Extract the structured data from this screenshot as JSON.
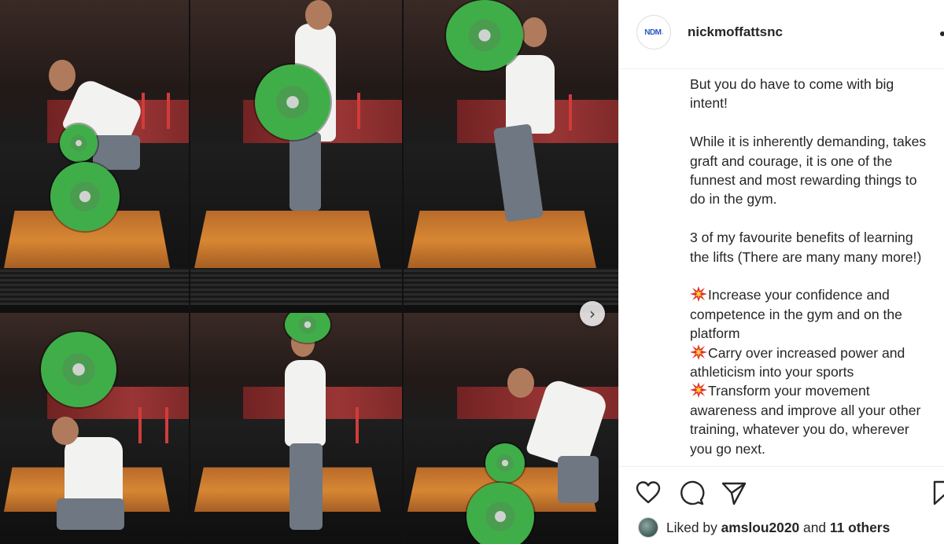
{
  "post": {
    "username": "nickmoffattsnc",
    "avatar_logo": "NDM"
  },
  "caption": {
    "lines": [
      "But you do have to come with big",
      "intent!",
      "",
      "While it is inherently demanding, takes",
      "graft and courage, it is one of the",
      "funnest and most rewarding things to",
      "do in the gym.",
      "",
      "3 of my favourite benefits of learning",
      "the lifts (There are many many more!)",
      "",
      "Increase your confidence and",
      "competence in the gym and on the",
      "platform",
      "Carry over increased power and",
      "athleticism into your sports",
      "Transform your movement",
      "awareness and improve all your other",
      "training, whatever you do, wherever",
      "you go next."
    ]
  },
  "media": {
    "next_icon": "chevron-right-icon",
    "next_glyph": "›"
  },
  "actions": {
    "like_icon": "heart-icon",
    "comment_icon": "comment-icon",
    "share_icon": "share-icon",
    "save_icon": "bookmark-icon"
  },
  "likes": {
    "prefix": "Liked by ",
    "user": "amslou2020",
    "connector": " and ",
    "others": "11 others"
  },
  "colors": {
    "text": "#262626",
    "divider": "#efefef",
    "plate_green": "#3fae49",
    "explosion_red": "#e0342b"
  }
}
